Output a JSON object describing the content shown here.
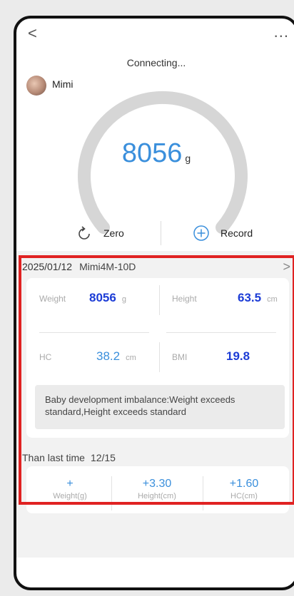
{
  "nav": {
    "back": "<",
    "more": "..."
  },
  "status": "Connecting...",
  "user": {
    "name": "Mimi"
  },
  "weight": {
    "value": "8056",
    "unit": "g"
  },
  "actions": {
    "zero": "Zero",
    "record": "Record"
  },
  "record": {
    "date": "2025/01/12",
    "device": "Mimi4M-10D",
    "chevron": ">",
    "metrics": {
      "weight": {
        "label": "Weight",
        "value": "8056",
        "unit": "g"
      },
      "height": {
        "label": "Height",
        "value": "63.5",
        "unit": "cm"
      },
      "hc": {
        "label": "HC",
        "value": "38.2",
        "unit": "cm"
      },
      "bmi": {
        "label": "BMI",
        "value": "19.8"
      }
    },
    "advice": "Baby development imbalance:Weight exceeds standard,Height exceeds standard"
  },
  "comparison": {
    "label": "Than last time",
    "date": "12/15",
    "items": [
      {
        "value": "+",
        "label": "Weight(g)"
      },
      {
        "value": "+3.30",
        "label": "Height(cm)"
      },
      {
        "value": "+1.60",
        "label": "HC(cm)"
      }
    ]
  },
  "colors": {
    "accent": "#3a8fdc",
    "bold_value": "#1c3cd6",
    "highlight": "#e02222",
    "gauge_track": "#d6d6d6"
  }
}
